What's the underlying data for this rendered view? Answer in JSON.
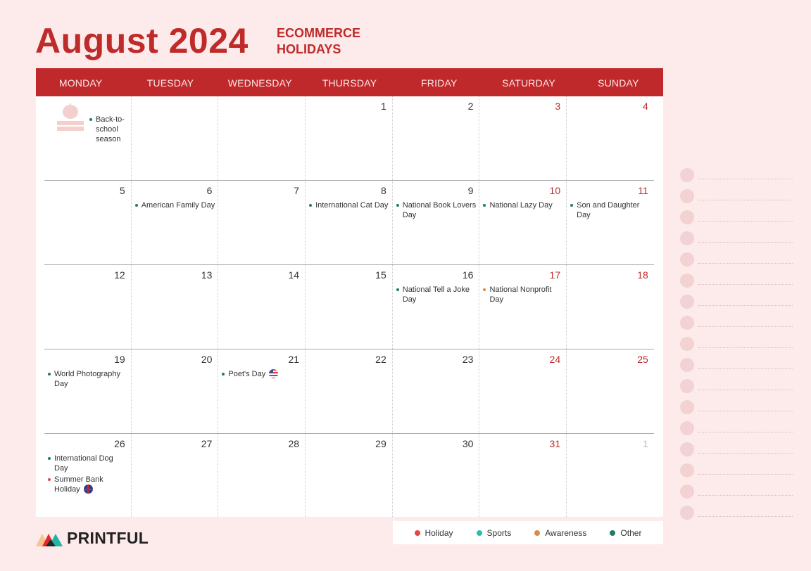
{
  "title": "August 2024",
  "subtitle_line1": "ECOMMERCE",
  "subtitle_line2": "HOLIDAYS",
  "brand": "PRINTFUL",
  "colors": {
    "accent": "#c0292b",
    "holiday": "#e84545",
    "sports": "#2bbdb0",
    "awareness": "#d98c4a",
    "other": "#1f7a6c"
  },
  "weekdays": [
    "MONDAY",
    "TUESDAY",
    "WEDNESDAY",
    "THURSDAY",
    "FRIDAY",
    "SATURDAY",
    "SUNDAY"
  ],
  "weeks": [
    [
      {
        "num": "",
        "events": [
          {
            "text": "Back-to-school season",
            "type": "other"
          }
        ],
        "icon": "apple-books-icon"
      },
      {
        "num": "",
        "events": []
      },
      {
        "num": "",
        "events": []
      },
      {
        "num": "1",
        "events": []
      },
      {
        "num": "2",
        "events": []
      },
      {
        "num": "3",
        "weekend": true,
        "events": []
      },
      {
        "num": "4",
        "weekend": true,
        "events": []
      }
    ],
    [
      {
        "num": "5",
        "events": []
      },
      {
        "num": "6",
        "events": [
          {
            "text": "American Family Day",
            "type": "other"
          }
        ]
      },
      {
        "num": "7",
        "events": []
      },
      {
        "num": "8",
        "events": [
          {
            "text": "International Cat Day",
            "type": "other"
          }
        ]
      },
      {
        "num": "9",
        "events": [
          {
            "text": "National Book Lovers Day",
            "type": "other"
          }
        ]
      },
      {
        "num": "10",
        "weekend": true,
        "events": [
          {
            "text": "National Lazy Day",
            "type": "other"
          }
        ]
      },
      {
        "num": "11",
        "weekend": true,
        "events": [
          {
            "text": "Son and Daughter Day",
            "type": "other"
          }
        ]
      }
    ],
    [
      {
        "num": "12",
        "events": []
      },
      {
        "num": "13",
        "events": []
      },
      {
        "num": "14",
        "events": []
      },
      {
        "num": "15",
        "events": []
      },
      {
        "num": "16",
        "events": [
          {
            "text": "National Tell a Joke Day",
            "type": "other"
          }
        ]
      },
      {
        "num": "17",
        "weekend": true,
        "events": [
          {
            "text": "National Nonprofit Day",
            "type": "awareness"
          }
        ]
      },
      {
        "num": "18",
        "weekend": true,
        "events": []
      }
    ],
    [
      {
        "num": "19",
        "events": [
          {
            "text": "World Photography Day",
            "type": "other"
          }
        ]
      },
      {
        "num": "20",
        "events": []
      },
      {
        "num": "21",
        "events": [
          {
            "text": "Poet's Day",
            "type": "other",
            "flag": "us"
          }
        ]
      },
      {
        "num": "22",
        "events": []
      },
      {
        "num": "23",
        "events": []
      },
      {
        "num": "24",
        "weekend": true,
        "events": []
      },
      {
        "num": "25",
        "weekend": true,
        "events": []
      }
    ],
    [
      {
        "num": "26",
        "events": [
          {
            "text": "International Dog Day",
            "type": "other"
          },
          {
            "text": "Summer Bank Holiday",
            "type": "holiday",
            "flag": "uk"
          }
        ]
      },
      {
        "num": "27",
        "events": []
      },
      {
        "num": "28",
        "events": []
      },
      {
        "num": "29",
        "events": []
      },
      {
        "num": "30",
        "events": []
      },
      {
        "num": "31",
        "weekend": true,
        "events": []
      },
      {
        "num": "1",
        "other_month": true,
        "events": []
      }
    ]
  ],
  "legend": [
    {
      "label": "Holiday",
      "type": "holiday"
    },
    {
      "label": "Sports",
      "type": "sports"
    },
    {
      "label": "Awareness",
      "type": "awareness"
    },
    {
      "label": "Other",
      "type": "other"
    }
  ],
  "checklist_rows": 17
}
